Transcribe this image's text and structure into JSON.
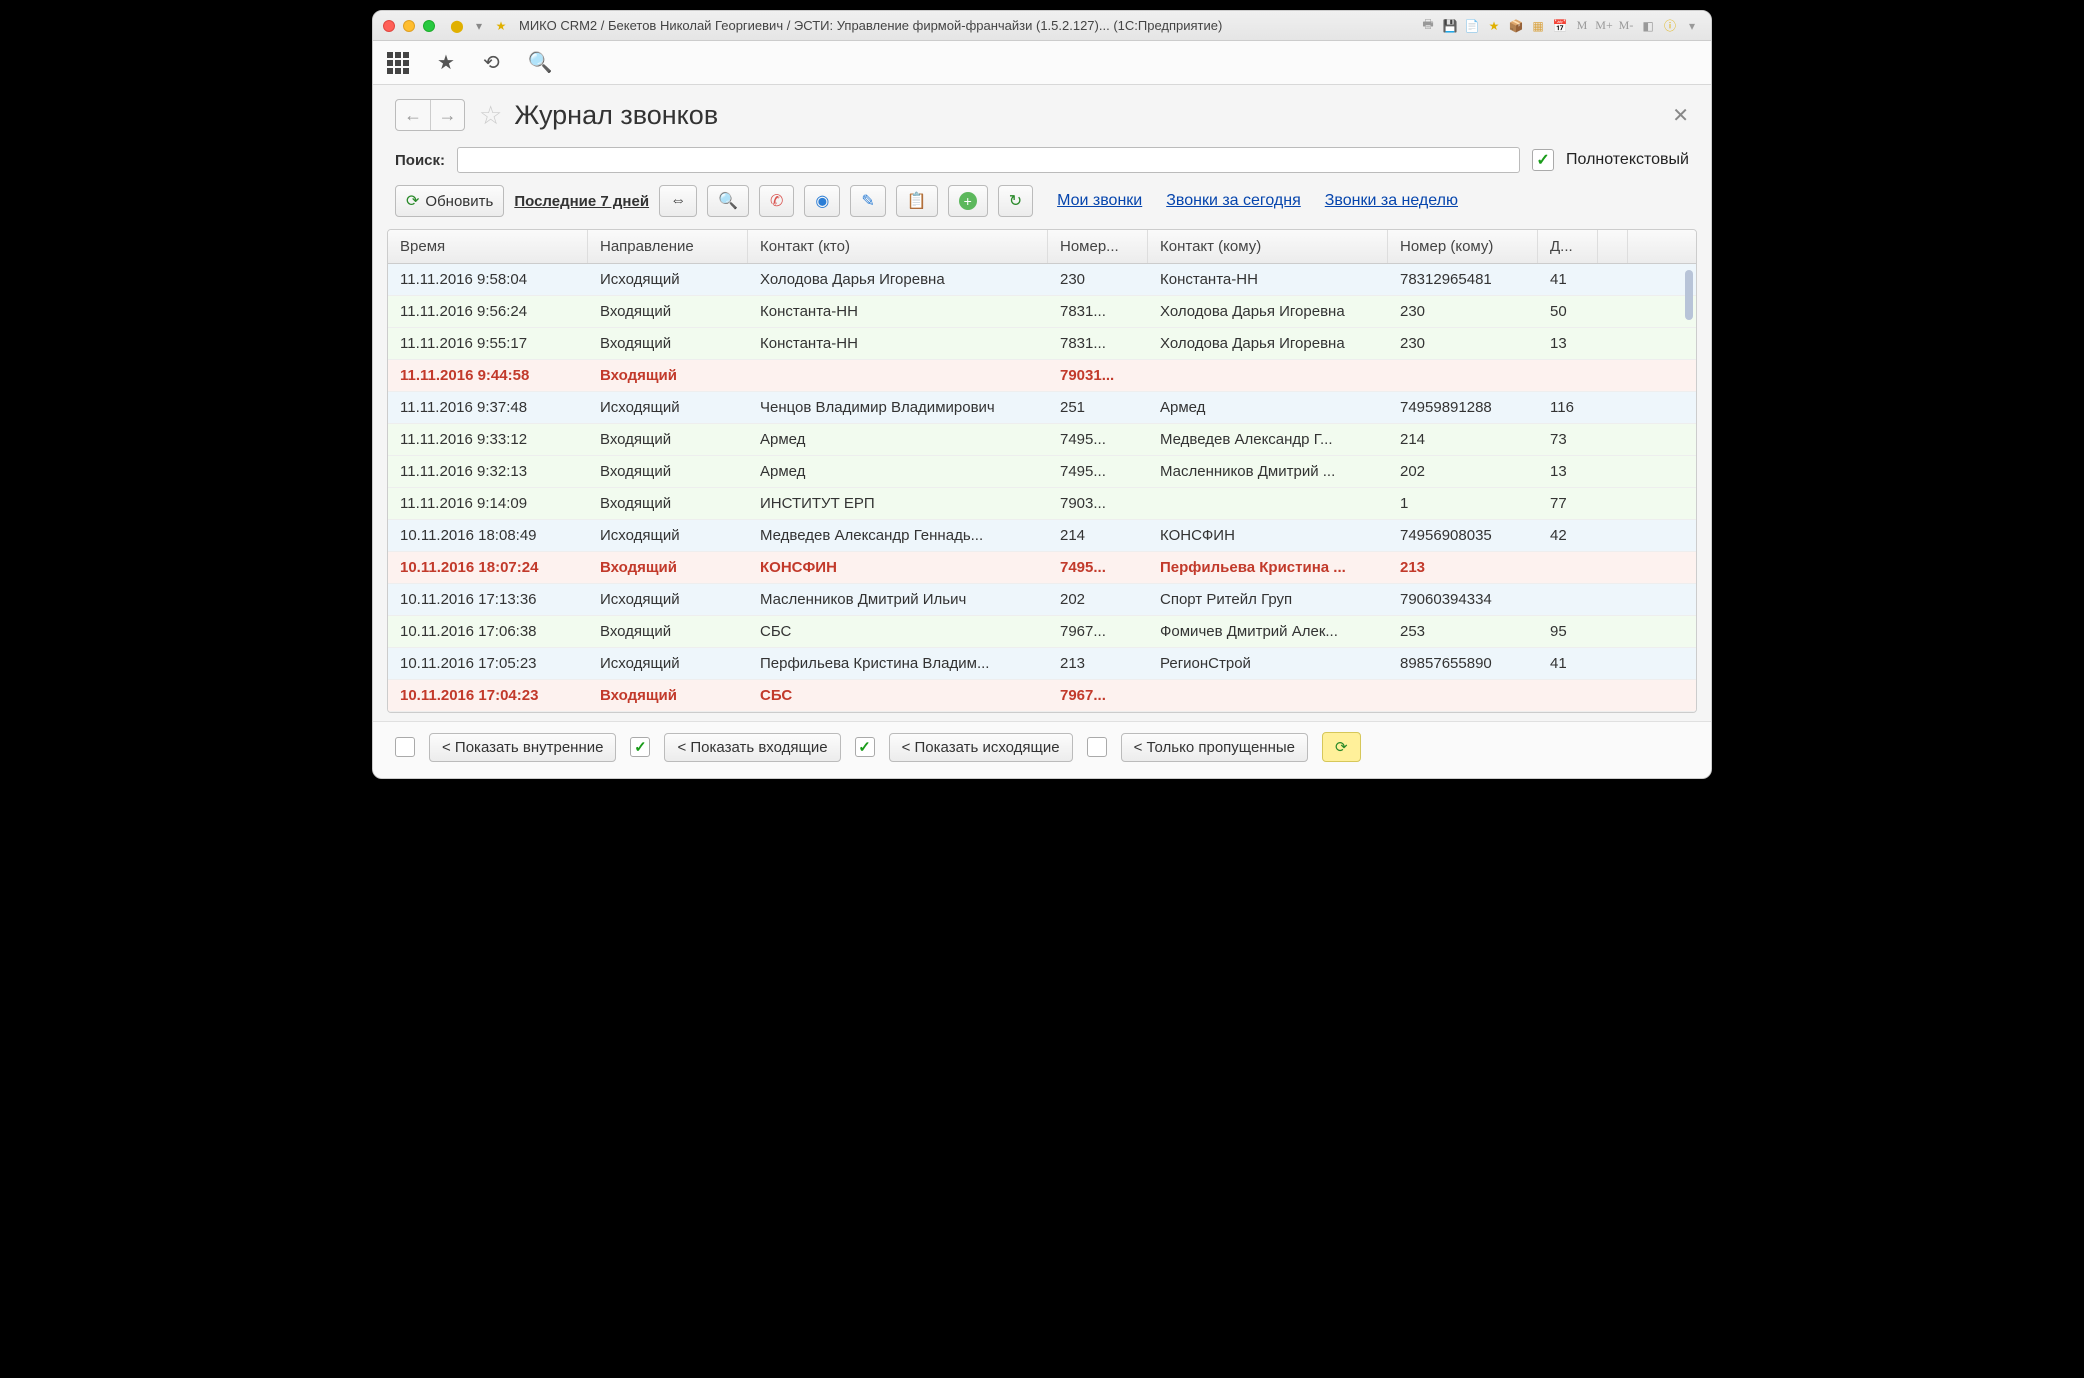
{
  "titlebar": {
    "title": "МИКО CRM2 / Бекетов Николай Георгиевич / ЭСТИ: Управление фирмой-франчайзи (1.5.2.127)...  (1С:Предприятие)"
  },
  "page": {
    "title": "Журнал звонков"
  },
  "search": {
    "label": "Поиск:",
    "fulltext_label": "Полнотекстовый"
  },
  "toolbar": {
    "refresh": "Обновить",
    "period": "Последние 7 дней",
    "my_calls": "Мои звонки",
    "today_calls": "Звонки за сегодня",
    "week_calls": "Звонки за неделю"
  },
  "columns": {
    "time": "Время",
    "direction": "Направление",
    "contact_who": "Контакт (кто)",
    "number_who": "Номер...",
    "contact_whom": "Контакт (кому)",
    "number_whom": "Номер (кому)",
    "duration": "Д..."
  },
  "rows": [
    {
      "cls": "out",
      "time": "11.11.2016 9:58:04",
      "dir": "Исходящий",
      "cwho": "Холодова Дарья Игоревна",
      "nwho": "230",
      "cwhom": "Константа-НН",
      "nwhom": "78312965481",
      "dur": "41"
    },
    {
      "cls": "in",
      "time": "11.11.2016 9:56:24",
      "dir": "Входящий",
      "cwho": "Константа-НН",
      "nwho": "7831...",
      "cwhom": "Холодова Дарья Игоревна",
      "nwhom": "230",
      "dur": "50"
    },
    {
      "cls": "in",
      "time": "11.11.2016 9:55:17",
      "dir": "Входящий",
      "cwho": "Константа-НН",
      "nwho": "7831...",
      "cwhom": "Холодова Дарья Игоревна",
      "nwhom": "230",
      "dur": "13"
    },
    {
      "cls": "miss",
      "time": "11.11.2016 9:44:58",
      "dir": "Входящий",
      "cwho": "",
      "nwho": "79031...",
      "cwhom": "",
      "nwhom": "",
      "dur": ""
    },
    {
      "cls": "out",
      "time": "11.11.2016 9:37:48",
      "dir": "Исходящий",
      "cwho": "Ченцов Владимир Владимирович",
      "nwho": "251",
      "cwhom": "Армед",
      "nwhom": "74959891288",
      "dur": "116"
    },
    {
      "cls": "in",
      "time": "11.11.2016 9:33:12",
      "dir": "Входящий",
      "cwho": "Армед",
      "nwho": "7495...",
      "cwhom": "Медведев Александр Г...",
      "nwhom": "214",
      "dur": "73"
    },
    {
      "cls": "in",
      "time": "11.11.2016 9:32:13",
      "dir": "Входящий",
      "cwho": "Армед",
      "nwho": "7495...",
      "cwhom": "Масленников Дмитрий ...",
      "nwhom": "202",
      "dur": "13"
    },
    {
      "cls": "in",
      "time": "11.11.2016 9:14:09",
      "dir": "Входящий",
      "cwho": "ИНСТИТУТ ЕРП",
      "nwho": "7903...",
      "cwhom": "",
      "nwhom": "1",
      "dur": "77"
    },
    {
      "cls": "out",
      "time": "10.11.2016 18:08:49",
      "dir": "Исходящий",
      "cwho": "Медведев Александр Геннадь...",
      "nwho": "214",
      "cwhom": "КОНСФИН",
      "nwhom": "74956908035",
      "dur": "42"
    },
    {
      "cls": "miss",
      "time": "10.11.2016 18:07:24",
      "dir": "Входящий",
      "cwho": "КОНСФИН",
      "nwho": "7495...",
      "cwhom": "Перфильева Кристина ...",
      "nwhom": "213",
      "dur": ""
    },
    {
      "cls": "out",
      "time": "10.11.2016 17:13:36",
      "dir": "Исходящий",
      "cwho": "Масленников Дмитрий Ильич",
      "nwho": "202",
      "cwhom": "Спорт Ритейл Груп",
      "nwhom": "79060394334",
      "dur": ""
    },
    {
      "cls": "in",
      "time": "10.11.2016 17:06:38",
      "dir": "Входящий",
      "cwho": "СБС",
      "nwho": "7967...",
      "cwhom": "Фомичев Дмитрий Алек...",
      "nwhom": "253",
      "dur": "95"
    },
    {
      "cls": "out",
      "time": "10.11.2016 17:05:23",
      "dir": "Исходящий",
      "cwho": "Перфильева Кристина Владим...",
      "nwho": "213",
      "cwhom": "РегионСтрой",
      "nwhom": "89857655890",
      "dur": "41"
    },
    {
      "cls": "miss",
      "time": "10.11.2016 17:04:23",
      "dir": "Входящий",
      "cwho": "СБС",
      "nwho": "7967...",
      "cwhom": "",
      "nwhom": "",
      "dur": ""
    }
  ],
  "footer": {
    "show_internal": "< Показать внутренние",
    "show_incoming": "< Показать входящие",
    "show_outgoing": "< Показать исходящие",
    "only_missed": "< Только пропущенные"
  }
}
